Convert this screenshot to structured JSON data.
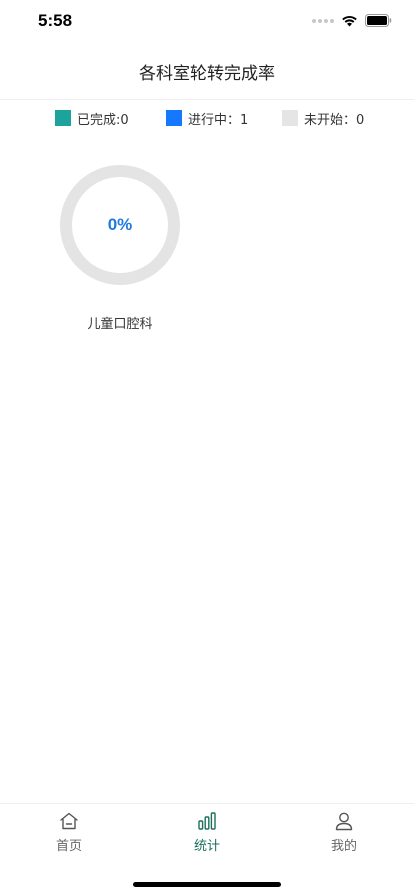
{
  "status_bar": {
    "time": "5:58"
  },
  "header": {
    "title": "各科室轮转完成率"
  },
  "legend": [
    {
      "label": "已完成:0",
      "color": "#1ba39c"
    },
    {
      "label": "进行中：1",
      "color": "#1677ff"
    },
    {
      "label": "未开始：0",
      "color": "#e5e5e5"
    }
  ],
  "departments": [
    {
      "name": "儿童口腔科",
      "percent_text": "0%",
      "completion": 0,
      "ring_color": "#e4e4e4",
      "text_color": "#1f7ae0"
    }
  ],
  "tab_bar": {
    "items": [
      {
        "label": "首页",
        "icon": "home-icon",
        "active": false
      },
      {
        "label": "统计",
        "icon": "bar-chart-icon",
        "active": true
      },
      {
        "label": "我的",
        "icon": "user-icon",
        "active": false
      }
    ],
    "active_color": "#1b6f5c",
    "inactive_color": "#666666"
  }
}
